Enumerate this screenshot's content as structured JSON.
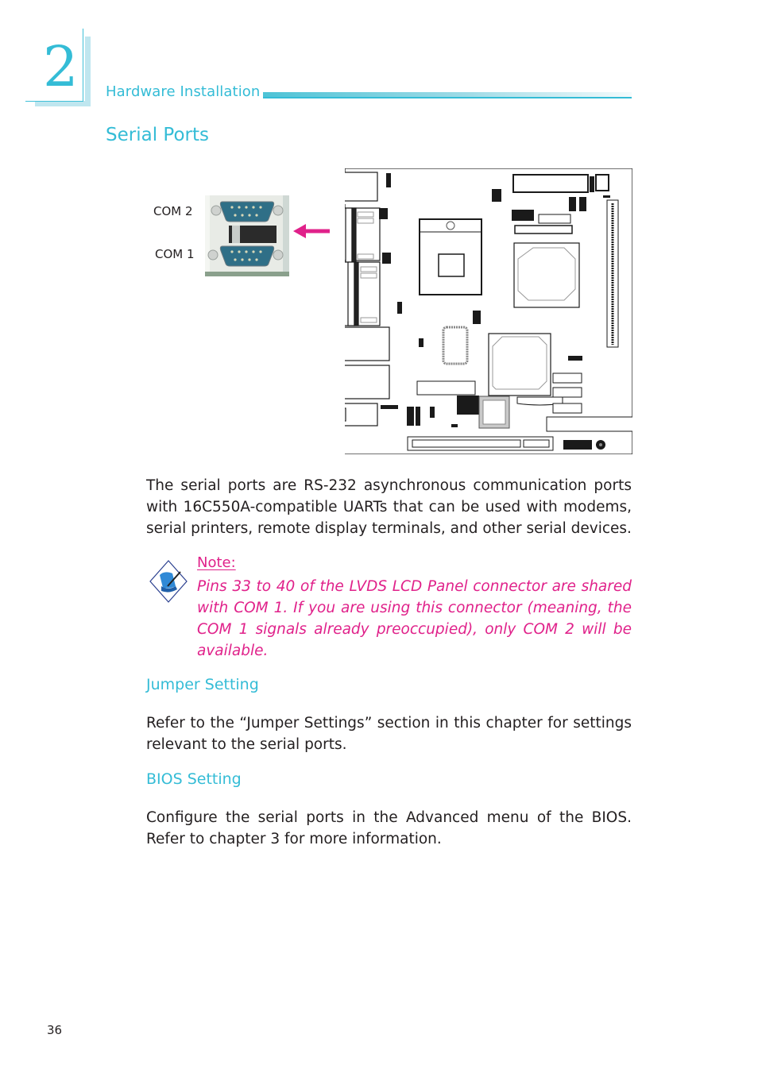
{
  "header": {
    "chapter_number": "2",
    "section_label": "Hardware Installation",
    "accent_color": "#34bcd6"
  },
  "page_title": "Serial Ports",
  "figure": {
    "com2_label": "COM  2",
    "com1_label": "COM  1",
    "arrow_color": "#e0218a",
    "board_icon": "motherboard-layout-diagram"
  },
  "intro_paragraph": "The serial ports are RS-232 asynchronous communication ports with 16C550A-compatible UARTs that can be used with modems, serial printers, remote display terminals, and other serial devices.",
  "note": {
    "icon": "note-pen-scroll-icon",
    "title": "Note:",
    "text": "Pins 33 to 40 of the LVDS LCD Panel connector are shared with COM 1. If you are using this connector (meaning, the COM 1 signals already preoccupied), only COM 2 will be available.",
    "color": "#e0218a"
  },
  "sections": [
    {
      "heading": "Jumper Setting",
      "text": "Refer to the “Jumper Settings” section in this chapter for settings relevant to the serial ports."
    },
    {
      "heading": "BIOS Setting",
      "text": "Configure the serial ports in the Advanced menu of the BIOS. Refer to chapter 3 for more information."
    }
  ],
  "footer": {
    "page_number": "36"
  }
}
